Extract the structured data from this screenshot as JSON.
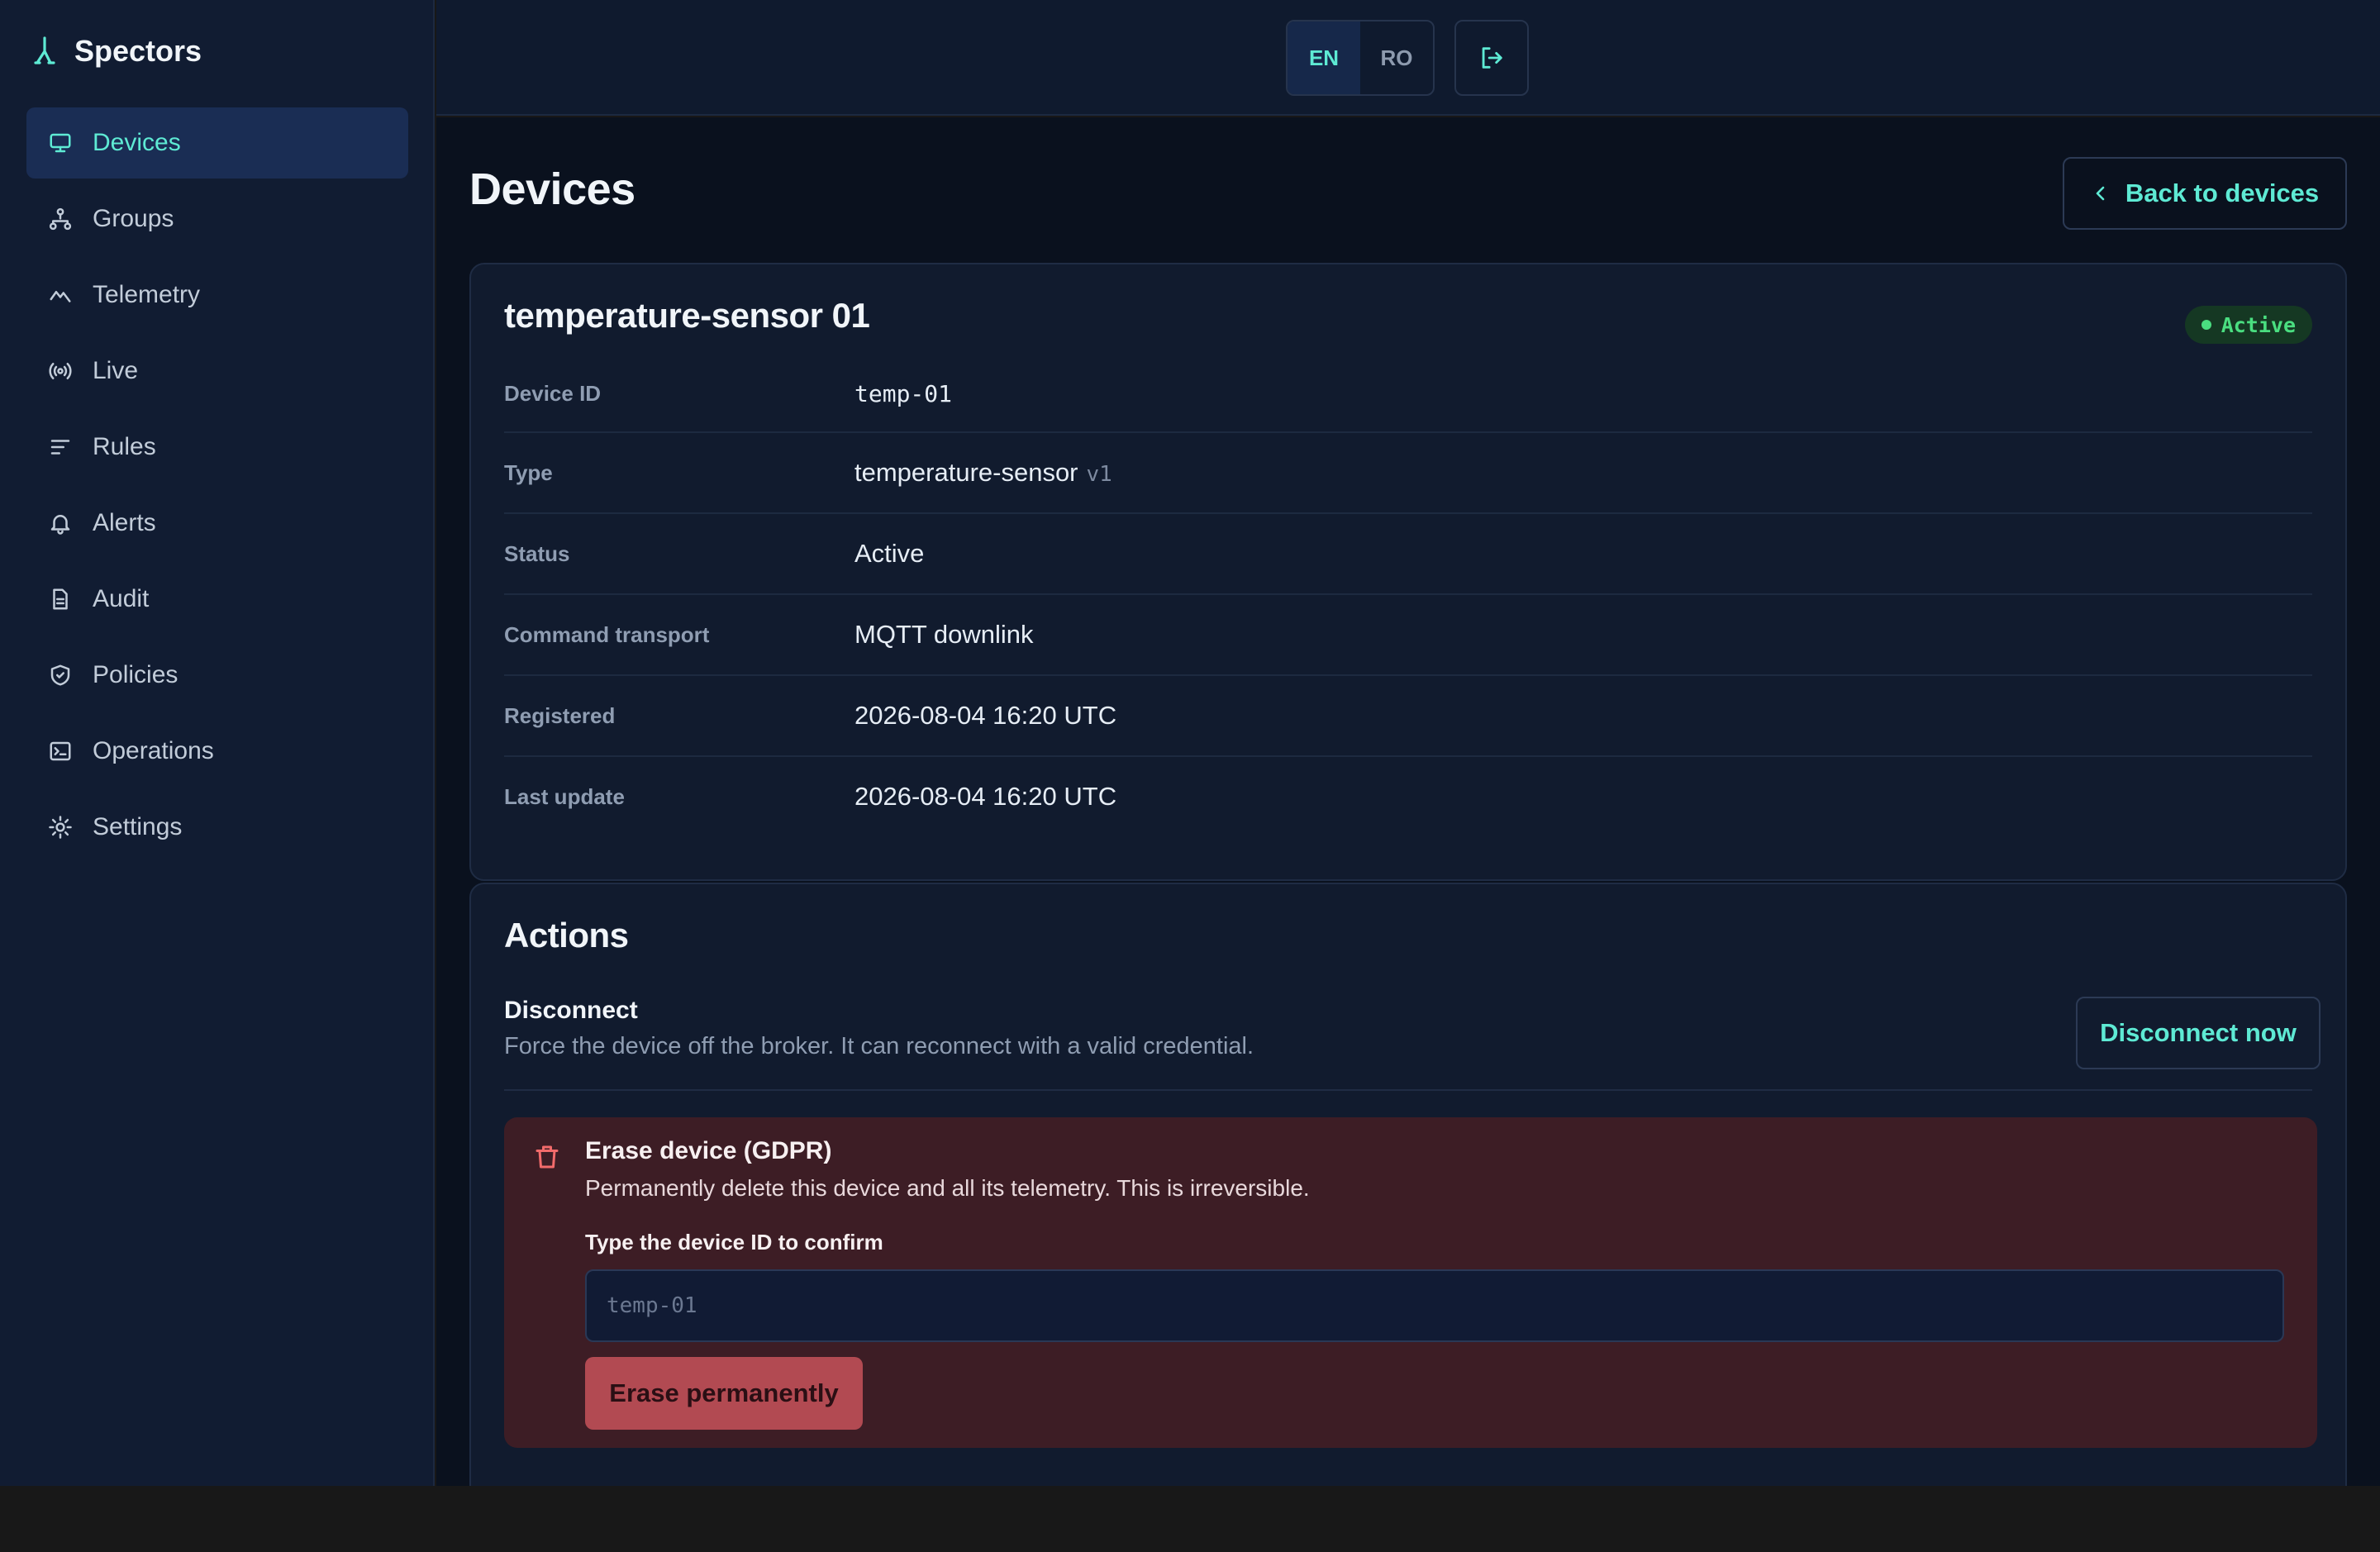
{
  "app": {
    "name": "Spectors"
  },
  "sidebar": {
    "items": [
      {
        "label": "Devices",
        "icon": "monitor-icon",
        "active": true
      },
      {
        "label": "Groups",
        "icon": "network-icon"
      },
      {
        "label": "Telemetry",
        "icon": "chart-line-icon"
      },
      {
        "label": "Live",
        "icon": "broadcast-icon"
      },
      {
        "label": "Rules",
        "icon": "rules-list-icon"
      },
      {
        "label": "Alerts",
        "icon": "bell-icon"
      },
      {
        "label": "Audit",
        "icon": "document-icon"
      },
      {
        "label": "Policies",
        "icon": "shield-icon"
      },
      {
        "label": "Operations",
        "icon": "terminal-icon"
      },
      {
        "label": "Settings",
        "icon": "gear-icon"
      }
    ]
  },
  "topbar": {
    "languages": [
      "EN",
      "RO"
    ],
    "active_language": "EN",
    "logout_icon": "logout-icon"
  },
  "page": {
    "title": "Devices",
    "back_label": "Back to devices"
  },
  "device": {
    "name": "temperature-sensor 01",
    "status_badge": "Active",
    "details": {
      "device_id_label": "Device ID",
      "device_id": "temp-01",
      "type_label": "Type",
      "type": "temperature-sensor",
      "type_version": "v1",
      "status_label": "Status",
      "status": "Active",
      "transport_label": "Command transport",
      "transport": "MQTT downlink",
      "registered_label": "Registered",
      "registered": "2026-08-04 16:20 UTC",
      "last_update_label": "Last update",
      "last_update": "2026-08-04 16:20 UTC"
    }
  },
  "actions": {
    "title": "Actions",
    "disconnect": {
      "title": "Disconnect",
      "description": "Force the device off the broker. It can reconnect with a valid credential.",
      "button": "Disconnect now"
    },
    "erase": {
      "title": "Erase device (GDPR)",
      "description": "Permanently delete this device and all its telemetry. This is irreversible.",
      "confirm_label": "Type the device ID to confirm",
      "placeholder": "temp-01",
      "value": "",
      "button": "Erase permanently"
    }
  },
  "colors": {
    "accent": "#5eead4",
    "active_badge": "#4ade80",
    "danger_bg": "#3d1d25",
    "danger_button": "#b24a52"
  }
}
